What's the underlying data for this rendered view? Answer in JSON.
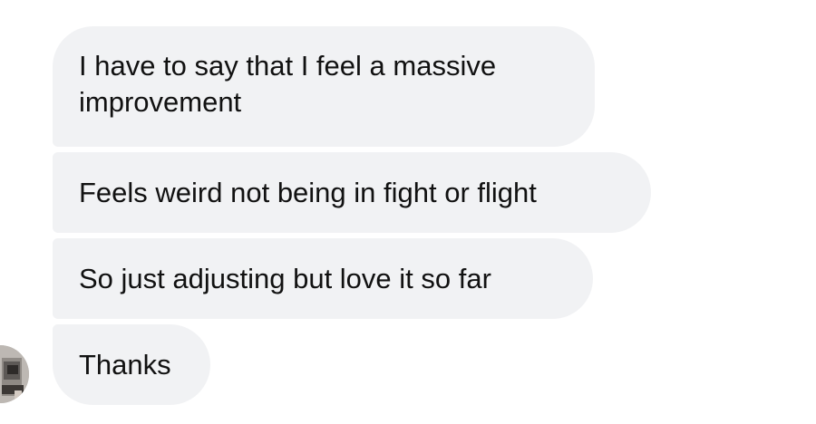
{
  "messages": [
    {
      "text": "I have to say that I feel a massive improvement"
    },
    {
      "text": "Feels weird not being in fight or flight"
    },
    {
      "text": "So just adjusting but love it so far"
    },
    {
      "text": "Thanks"
    }
  ],
  "colors": {
    "bubble_background": "#f1f2f4",
    "text": "#111111",
    "page_background": "#ffffff"
  },
  "icons": {
    "sender_avatar": "avatar-photo"
  }
}
